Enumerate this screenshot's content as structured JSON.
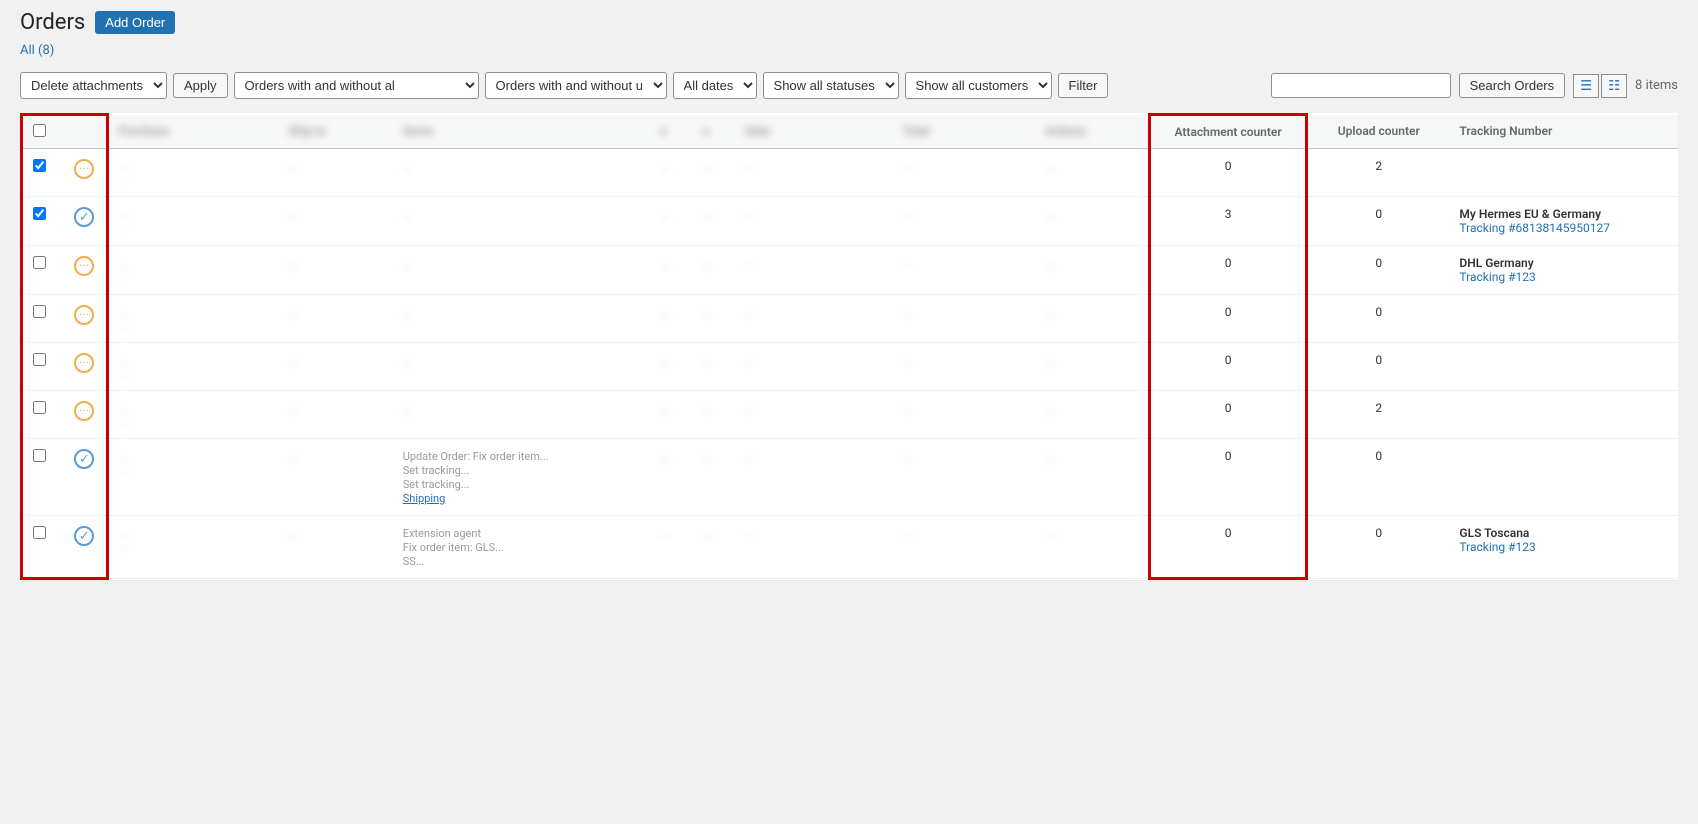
{
  "page": {
    "title": "Orders",
    "add_order_label": "Add Order",
    "all_label": "All",
    "all_count": "(8)"
  },
  "toolbar": {
    "bulk_action_label": "Delete attachments",
    "apply_label": "Apply",
    "orders_attachment_filter": "Orders with and without al",
    "orders_upload_filter": "Orders with and without u",
    "date_filter": "All dates",
    "status_filter": "Show all statuses",
    "customer_filter": "Show all customers",
    "filter_label": "Filter",
    "search_placeholder": "",
    "search_label": "Search Orders",
    "items_count": "8 items"
  },
  "columns": {
    "cb": "",
    "status": "",
    "order": "Purchase",
    "ship_to": "Ship to",
    "items": "Items",
    "col1": "",
    "col2": "",
    "billing": "Date",
    "total": "Total",
    "actions": "Actions",
    "attachment_counter": "Attachment counter",
    "upload_counter": "Upload counter",
    "tracking_number": "Tracking Number"
  },
  "rows": [
    {
      "id": 1,
      "checked": true,
      "status": "pending",
      "order": "...",
      "order_email": "...",
      "purchase": "...",
      "ship_to": "",
      "items": "...",
      "col1": "...",
      "col2": "...",
      "billing": "...",
      "total": "...",
      "actions": "...",
      "attachment_counter": 0,
      "upload_counter": 2,
      "tracking_carrier": "",
      "tracking_link": "",
      "tracking_text": ""
    },
    {
      "id": 2,
      "checked": true,
      "status": "completed",
      "order": "...",
      "order_email": "...",
      "purchase": "...",
      "ship_to": "",
      "items": "...",
      "col1": "...",
      "col2": "...",
      "billing": "...",
      "total": "...",
      "actions": "...",
      "attachment_counter": 3,
      "upload_counter": 0,
      "tracking_carrier": "My Hermes EU & Germany",
      "tracking_link": "Tracking #68138145950127",
      "tracking_text": "Tracking #68138145950127"
    },
    {
      "id": 3,
      "checked": false,
      "status": "pending",
      "order": "...",
      "order_email": "...",
      "purchase": "...",
      "ship_to": "",
      "items": "...",
      "col1": "...",
      "col2": "...",
      "billing": "...",
      "total": "...",
      "actions": "...",
      "attachment_counter": 0,
      "upload_counter": 0,
      "tracking_carrier": "DHL Germany",
      "tracking_link": "Tracking #123",
      "tracking_text": "Tracking #123"
    },
    {
      "id": 4,
      "checked": false,
      "status": "pending",
      "order": "...",
      "order_email": "...",
      "purchase": "...",
      "ship_to": "",
      "items": "...",
      "col1": "...",
      "col2": "...",
      "billing": "...",
      "total": "...",
      "actions": "...",
      "attachment_counter": 0,
      "upload_counter": 0,
      "tracking_carrier": "",
      "tracking_link": "",
      "tracking_text": ""
    },
    {
      "id": 5,
      "checked": false,
      "status": "pending",
      "order": "...",
      "order_email": "...",
      "purchase": "...",
      "ship_to": "",
      "items": "...",
      "col1": "...",
      "col2": "...",
      "billing": "...",
      "total": "...",
      "actions": "...",
      "attachment_counter": 0,
      "upload_counter": 0,
      "tracking_carrier": "",
      "tracking_link": "",
      "tracking_text": ""
    },
    {
      "id": 6,
      "checked": false,
      "status": "pending",
      "order": "...",
      "order_email": "...",
      "purchase": "...",
      "ship_to": "",
      "items": "...",
      "col1": "...",
      "col2": "...",
      "billing": "...",
      "total": "...",
      "actions": "...",
      "attachment_counter": 0,
      "upload_counter": 2,
      "tracking_carrier": "",
      "tracking_link": "",
      "tracking_text": ""
    },
    {
      "id": 7,
      "checked": false,
      "status": "completed",
      "order": "...",
      "order_email": "...",
      "purchase": "...",
      "ship_to": "...",
      "items": "Update Order: Fix order item...\nSet tracking...\nSet tracking...\nShipping",
      "col1": "...",
      "col2": "...",
      "billing": "...",
      "total": "...",
      "actions": "...",
      "attachment_counter": 0,
      "upload_counter": 0,
      "tracking_carrier": "",
      "tracking_link": "",
      "tracking_text": ""
    },
    {
      "id": 8,
      "checked": false,
      "status": "completed",
      "order": "...",
      "order_email": "...",
      "purchase": "...",
      "ship_to": "...",
      "items": "Extension agent\nFix order item: GLS...\nSS...",
      "col1": "...",
      "col2": "...",
      "billing": "...",
      "total": "...",
      "actions": "...",
      "attachment_counter": 0,
      "upload_counter": 0,
      "tracking_carrier": "GLS Toscana",
      "tracking_link": "Tracking #123",
      "tracking_text": "Tracking #123"
    }
  ]
}
